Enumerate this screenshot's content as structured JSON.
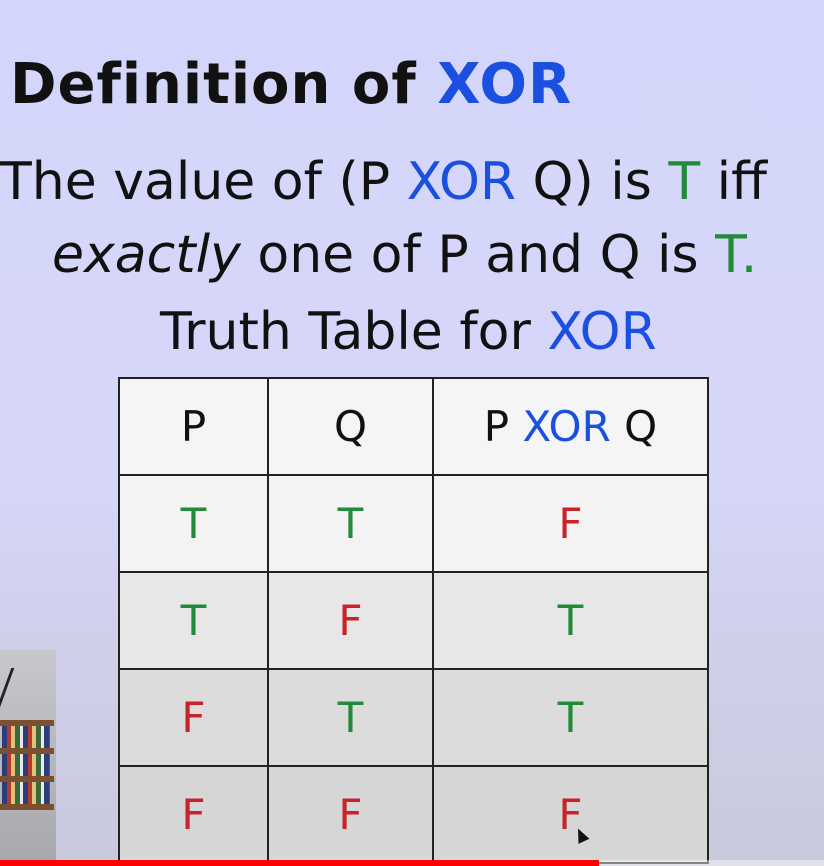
{
  "title": {
    "text": "Definition of ",
    "highlight": "XOR"
  },
  "definition": {
    "line1": {
      "a": "The value of (P ",
      "op": "XOR",
      "b": " Q) is ",
      "val": "T",
      "c": " iff"
    },
    "line2": {
      "em": "exactly",
      "a": " one of P and Q is ",
      "val": "T",
      "end": "."
    }
  },
  "table_title": {
    "text": "Truth Table for ",
    "highlight": "XOR"
  },
  "truth_table": {
    "headers": {
      "p": "P",
      "q": "Q",
      "result_a": "P ",
      "result_op": "XOR",
      "result_b": " Q"
    },
    "rows": [
      {
        "p": "T",
        "q": "T",
        "r": "F"
      },
      {
        "p": "T",
        "q": "F",
        "r": "T"
      },
      {
        "p": "F",
        "q": "T",
        "r": "T"
      },
      {
        "p": "F",
        "q": "F",
        "r": "F"
      }
    ]
  },
  "colors": {
    "true": "#228b3a",
    "false": "#c8222a",
    "keyword": "#1a4fe0",
    "progress": "#ff0000"
  },
  "video_progress_fraction": 0.727
}
